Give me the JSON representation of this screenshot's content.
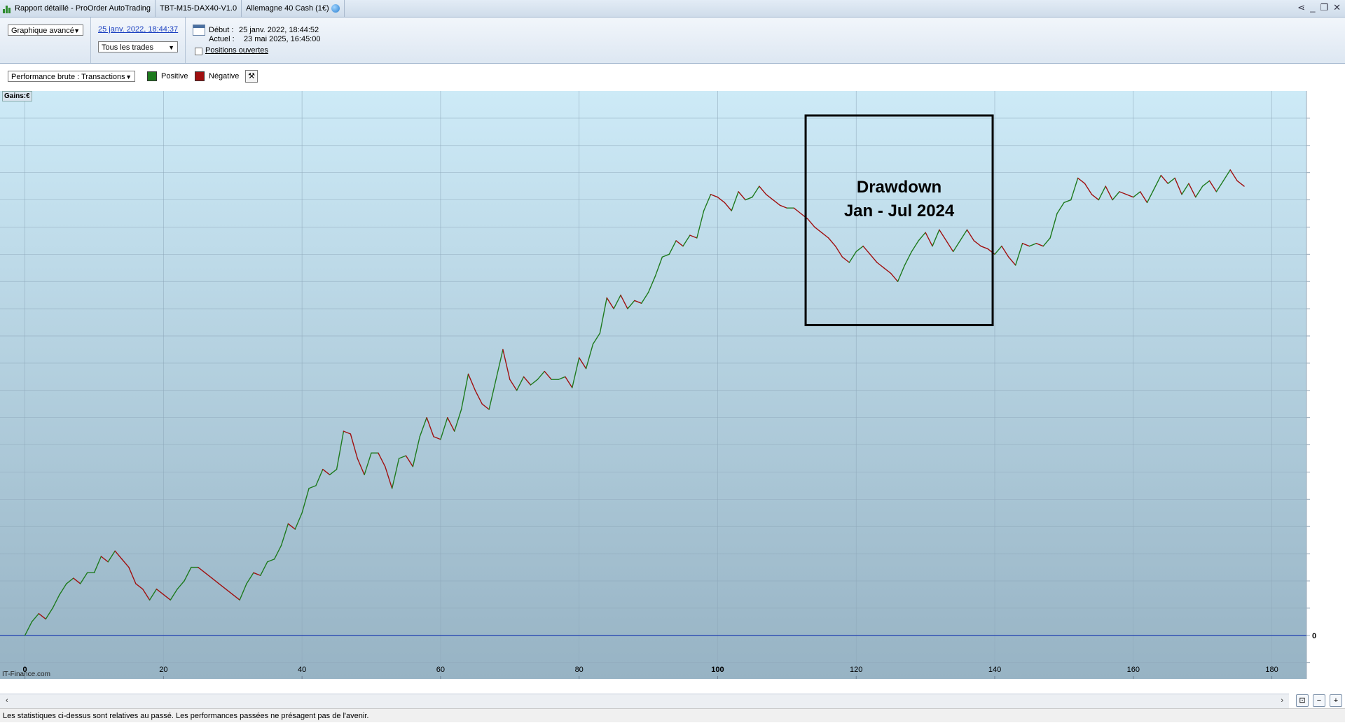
{
  "window": {
    "title": "Rapport détaillé - ProOrder AutoTrading",
    "strategy": "TBT-M15-DAX40-V1.0",
    "instrument": "Allemagne 40 Cash (1€)"
  },
  "toolbar": {
    "view_select": "Graphique avancé",
    "date_link": "25 janv. 2022, 18:44:37",
    "trades_select": "Tous les trades",
    "debut_label": "Début :",
    "debut_value": "25 janv. 2022, 18:44:52",
    "actuel_label": "Actuel :",
    "actuel_value": "23 mai 2025, 16:45:00",
    "positions_label": "Positions ouvertes"
  },
  "legend": {
    "metric_select": "Performance brute : Transactions",
    "positive_label": "Positive",
    "negative_label": "Négative",
    "positive_color": "#1e7a1e",
    "negative_color": "#a01010"
  },
  "chart_data": {
    "type": "line",
    "ylabel": "Gains:€",
    "xlim": [
      -3.6,
      185
    ],
    "ylim": [
      -1.6,
      20
    ],
    "x_ticks": [
      "0",
      "20",
      "40",
      "60",
      "80",
      "100",
      "120",
      "140",
      "160",
      "180"
    ],
    "y_tick_label": "0",
    "grid": true,
    "colors": {
      "up": "#1e7a1e",
      "down": "#a01010",
      "zero_line": "#1f3fb0"
    },
    "annotation": {
      "line1": "Drawdown",
      "line2": "Jan - Jul 2024",
      "x_range": [
        112.7,
        139.7
      ]
    },
    "watermark": "IT-Finance.com",
    "series": [
      {
        "values": [
          [
            0,
            0
          ],
          [
            1,
            0.5
          ],
          [
            2,
            0.8
          ],
          [
            3,
            0.6
          ],
          [
            4,
            1.0
          ],
          [
            5,
            1.5
          ],
          [
            6,
            1.9
          ],
          [
            7,
            2.1
          ],
          [
            8,
            1.9
          ],
          [
            9,
            2.3
          ],
          [
            10,
            2.3
          ],
          [
            11,
            2.9
          ],
          [
            12,
            2.7
          ],
          [
            13,
            3.1
          ],
          [
            14,
            2.8
          ],
          [
            15,
            2.5
          ],
          [
            16,
            1.9
          ],
          [
            17,
            1.7
          ],
          [
            18,
            1.3
          ],
          [
            19,
            1.7
          ],
          [
            20,
            1.5
          ],
          [
            21,
            1.3
          ],
          [
            22,
            1.7
          ],
          [
            23,
            2.0
          ],
          [
            24,
            2.5
          ],
          [
            25,
            2.5
          ],
          [
            26,
            2.3
          ],
          [
            27,
            2.1
          ],
          [
            28,
            1.9
          ],
          [
            29,
            1.7
          ],
          [
            30,
            1.5
          ],
          [
            31,
            1.3
          ],
          [
            32,
            1.9
          ],
          [
            33,
            2.3
          ],
          [
            34,
            2.2
          ],
          [
            35,
            2.7
          ],
          [
            36,
            2.8
          ],
          [
            37,
            3.3
          ],
          [
            38,
            4.1
          ],
          [
            39,
            3.9
          ],
          [
            40,
            4.5
          ],
          [
            41,
            5.4
          ],
          [
            42,
            5.5
          ],
          [
            43,
            6.1
          ],
          [
            44,
            5.9
          ],
          [
            45,
            6.1
          ],
          [
            46,
            7.5
          ],
          [
            47,
            7.4
          ],
          [
            48,
            6.5
          ],
          [
            49,
            5.9
          ],
          [
            50,
            6.7
          ],
          [
            51,
            6.7
          ],
          [
            52,
            6.2
          ],
          [
            53,
            5.4
          ],
          [
            54,
            6.5
          ],
          [
            55,
            6.6
          ],
          [
            56,
            6.2
          ],
          [
            57,
            7.3
          ],
          [
            58,
            8.0
          ],
          [
            59,
            7.3
          ],
          [
            60,
            7.2
          ],
          [
            61,
            8.0
          ],
          [
            62,
            7.5
          ],
          [
            63,
            8.3
          ],
          [
            64,
            9.6
          ],
          [
            65,
            9.0
          ],
          [
            66,
            8.5
          ],
          [
            67,
            8.3
          ],
          [
            68,
            9.4
          ],
          [
            69,
            10.5
          ],
          [
            70,
            9.4
          ],
          [
            71,
            9.0
          ],
          [
            72,
            9.5
          ],
          [
            73,
            9.2
          ],
          [
            74,
            9.4
          ],
          [
            75,
            9.7
          ],
          [
            76,
            9.4
          ],
          [
            77,
            9.4
          ],
          [
            78,
            9.5
          ],
          [
            79,
            9.1
          ],
          [
            80,
            10.2
          ],
          [
            81,
            9.8
          ],
          [
            82,
            10.7
          ],
          [
            83,
            11.1
          ],
          [
            84,
            12.4
          ],
          [
            85,
            12.0
          ],
          [
            86,
            12.5
          ],
          [
            87,
            12.0
          ],
          [
            88,
            12.3
          ],
          [
            89,
            12.2
          ],
          [
            90,
            12.6
          ],
          [
            91,
            13.2
          ],
          [
            92,
            13.9
          ],
          [
            93,
            14.0
          ],
          [
            94,
            14.5
          ],
          [
            95,
            14.3
          ],
          [
            96,
            14.7
          ],
          [
            97,
            14.6
          ],
          [
            98,
            15.6
          ],
          [
            99,
            16.2
          ],
          [
            100,
            16.1
          ],
          [
            101,
            15.9
          ],
          [
            102,
            15.6
          ],
          [
            103,
            16.3
          ],
          [
            104,
            16.0
          ],
          [
            105,
            16.1
          ],
          [
            106,
            16.5
          ],
          [
            107,
            16.2
          ],
          [
            108,
            16.0
          ],
          [
            109,
            15.8
          ],
          [
            110,
            15.7
          ],
          [
            111,
            15.7
          ],
          [
            112,
            15.5
          ],
          [
            113,
            15.3
          ],
          [
            114,
            15.0
          ],
          [
            115,
            14.8
          ],
          [
            116,
            14.6
          ],
          [
            117,
            14.3
          ],
          [
            118,
            13.9
          ],
          [
            119,
            13.7
          ],
          [
            120,
            14.1
          ],
          [
            121,
            14.3
          ],
          [
            122,
            14.0
          ],
          [
            123,
            13.7
          ],
          [
            124,
            13.5
          ],
          [
            125,
            13.3
          ],
          [
            126,
            13.0
          ],
          [
            127,
            13.6
          ],
          [
            128,
            14.1
          ],
          [
            129,
            14.5
          ],
          [
            130,
            14.8
          ],
          [
            131,
            14.3
          ],
          [
            132,
            14.9
          ],
          [
            133,
            14.5
          ],
          [
            134,
            14.1
          ],
          [
            135,
            14.5
          ],
          [
            136,
            14.9
          ],
          [
            137,
            14.5
          ],
          [
            138,
            14.3
          ],
          [
            139,
            14.2
          ],
          [
            140,
            14.0
          ],
          [
            141,
            14.3
          ],
          [
            142,
            13.9
          ],
          [
            143,
            13.6
          ],
          [
            144,
            14.4
          ],
          [
            145,
            14.3
          ],
          [
            146,
            14.4
          ],
          [
            147,
            14.3
          ],
          [
            148,
            14.6
          ],
          [
            149,
            15.5
          ],
          [
            150,
            15.9
          ],
          [
            151,
            16.0
          ],
          [
            152,
            16.8
          ],
          [
            153,
            16.6
          ],
          [
            154,
            16.2
          ],
          [
            155,
            16.0
          ],
          [
            156,
            16.5
          ],
          [
            157,
            16.0
          ],
          [
            158,
            16.3
          ],
          [
            159,
            16.2
          ],
          [
            160,
            16.1
          ],
          [
            161,
            16.3
          ],
          [
            162,
            15.9
          ],
          [
            163,
            16.4
          ],
          [
            164,
            16.9
          ],
          [
            165,
            16.6
          ],
          [
            166,
            16.8
          ],
          [
            167,
            16.2
          ],
          [
            168,
            16.6
          ],
          [
            169,
            16.1
          ],
          [
            170,
            16.5
          ],
          [
            171,
            16.7
          ],
          [
            172,
            16.3
          ],
          [
            173,
            16.7
          ],
          [
            174,
            17.1
          ],
          [
            175,
            16.7
          ],
          [
            176,
            16.5
          ]
        ]
      }
    ]
  },
  "footer": {
    "disclaimer": "Les statistiques ci-dessus sont relatives au passé. Les performances passées ne présagent pas de l'avenir."
  }
}
